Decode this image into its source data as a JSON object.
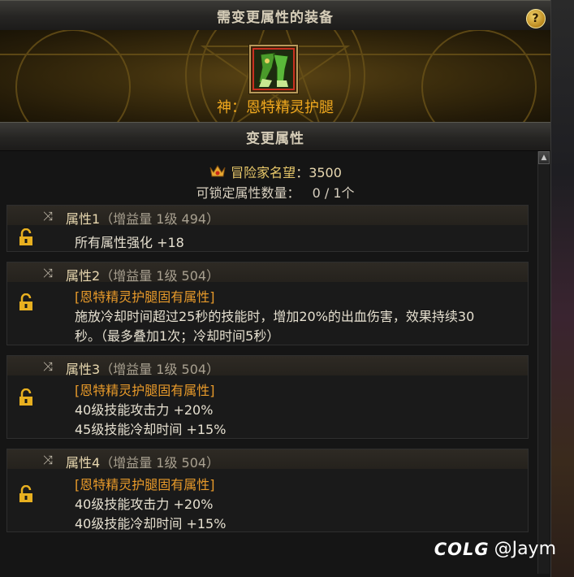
{
  "window": {
    "title": "需变更属性的装备",
    "help_icon": "?",
    "section_title": "变更属性"
  },
  "item": {
    "name": "神：恩特精灵护腿",
    "icon": "leg-armor-icon"
  },
  "reputation": {
    "label": "冒险家名望",
    "value": "：3500",
    "icon": "reputation-crown-icon"
  },
  "lockable": {
    "label": "可锁定属性数量：",
    "value": "0 / 1个"
  },
  "attributes": [
    {
      "title": "属性1",
      "gain": "（增益量 1级 494）",
      "lines": [
        {
          "text": "所有属性强化 +18",
          "color": "white"
        }
      ]
    },
    {
      "title": "属性2",
      "gain": "（增益量 1级 504）",
      "lines": [
        {
          "text": "[恩特精灵护腿固有属性]",
          "color": "orange"
        },
        {
          "text": "施放冷却时间超过25秒的技能时，增加20%的出血伤害，效果持续30",
          "color": "white"
        },
        {
          "text": "秒。（最多叠加1次；冷却时间5秒）",
          "color": "white"
        }
      ]
    },
    {
      "title": "属性3",
      "gain": "（增益量 1级 504）",
      "lines": [
        {
          "text": "[恩特精灵护腿固有属性]",
          "color": "orange"
        },
        {
          "text": "40级技能攻击力 +20%",
          "color": "white"
        },
        {
          "text": "45级技能冷却时间 +15%",
          "color": "white"
        }
      ]
    },
    {
      "title": "属性4",
      "gain": "（增益量 1级 504）",
      "lines": [
        {
          "text": "[恩特精灵护腿固有属性]",
          "color": "orange"
        },
        {
          "text": "40级技能攻击力 +20%",
          "color": "white"
        },
        {
          "text": "40级技能冷却时间 +15%",
          "color": "white"
        }
      ]
    }
  ],
  "watermark": {
    "logo": "COLG",
    "user": "@Jaym"
  },
  "colors": {
    "item_name": "#f0a81e",
    "fixed_attr": "#e89a2a",
    "lock": "#e8b020"
  }
}
